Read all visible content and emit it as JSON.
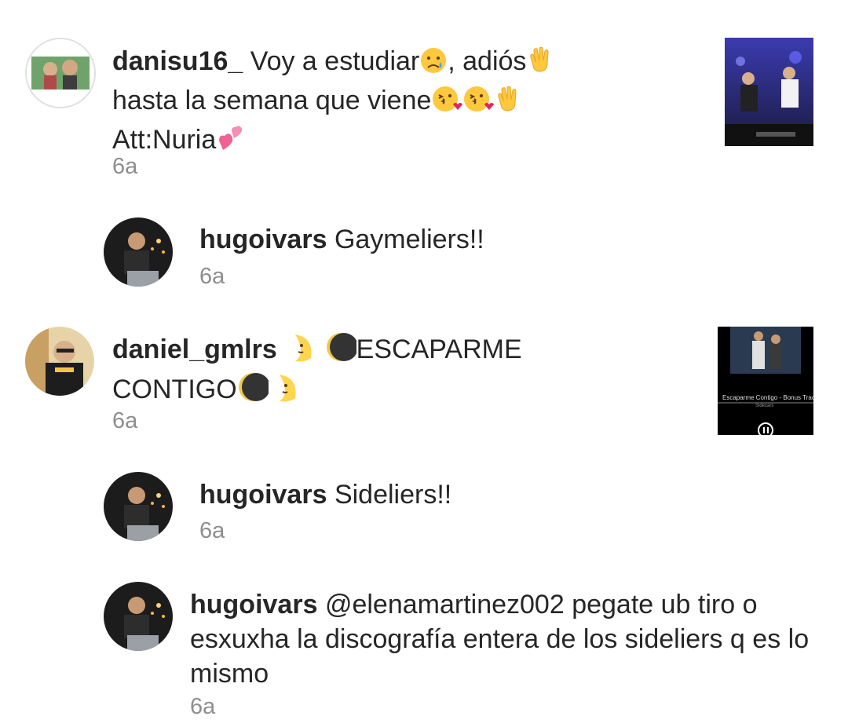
{
  "comments": [
    {
      "username": "danisu16_",
      "lines": [
        "Voy a estudiar",
        ", adiós",
        "hasta la semana que viene",
        "Att:Nuria"
      ],
      "emoji": [
        "sad-relieved-face",
        "waving-hand",
        "face-blowing-kiss",
        "face-blowing-kiss",
        "waving-hand",
        "two-hearts"
      ],
      "time": "6a"
    },
    {
      "username": "hugoivars",
      "text": "Gaymeliers!!",
      "time": "6a"
    },
    {
      "username": "daniel_gmlrs",
      "lines": [
        "ESCAPARME",
        "CONTIGO"
      ],
      "emoji": [
        "crescent-moon-face",
        "new-moon",
        "new-moon",
        "crescent-moon-face"
      ],
      "thumbnail_lines": [
        "Escaparme Contigo - Bonus Track",
        "Sidecars"
      ],
      "time": "6a"
    },
    {
      "username": "hugoivars",
      "text": "Sideliers!!",
      "time": "6a"
    },
    {
      "username": "hugoivars",
      "text": "@elenamartinez002 pegate ub tiro o esxuxha la discografía entera de los sideliers q es lo mismo",
      "time": "6a"
    }
  ],
  "colors": {
    "text": "#262626",
    "timestamp": "#8e8e8e",
    "background": "#ffffff"
  }
}
